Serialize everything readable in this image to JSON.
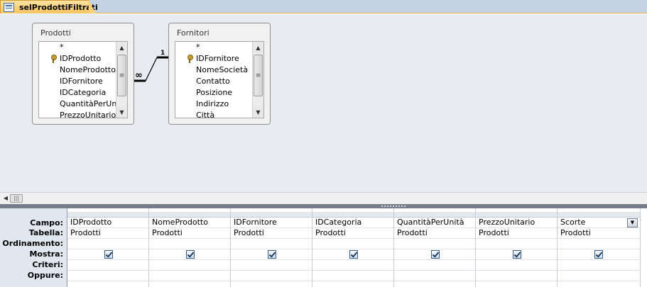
{
  "tab": {
    "icon": "query-icon",
    "label": "selProdottiFiltrati"
  },
  "diagram": {
    "tables": [
      {
        "title": "Prodotti",
        "fields": [
          "*",
          "IDProdotto",
          "NomeProdotto",
          "IDFornitore",
          "IDCategoria",
          "QuantitàPerUni",
          "PrezzoUnitario"
        ],
        "key_field_index": 1
      },
      {
        "title": "Fornitori",
        "fields": [
          "*",
          "IDFornitore",
          "NomeSocietà",
          "Contatto",
          "Posizione",
          "Indirizzo",
          "Città"
        ],
        "key_field_index": 1
      }
    ],
    "relationship": {
      "one_label": "1",
      "many_label": "∞"
    }
  },
  "grid": {
    "row_labels": [
      "Campo:",
      "Tabella:",
      "Ordinamento:",
      "Mostra:",
      "Criteri:",
      "Oppure:"
    ],
    "columns": [
      {
        "field": "IDProdotto",
        "table": "Prodotti",
        "show": true
      },
      {
        "field": "NomeProdotto",
        "table": "Prodotti",
        "show": true
      },
      {
        "field": "IDFornitore",
        "table": "Prodotti",
        "show": true
      },
      {
        "field": "IDCategoria",
        "table": "Prodotti",
        "show": true
      },
      {
        "field": "QuantitàPerUnità",
        "table": "Prodotti",
        "show": true
      },
      {
        "field": "PrezzoUnitario",
        "table": "Prodotti",
        "show": true
      },
      {
        "field": "Scorte",
        "table": "Prodotti",
        "show": true
      }
    ]
  },
  "colors": {
    "tab_active": "#f7c35e",
    "pane_bg": "#e8ecf1",
    "grid_label_bg": "#e1e7ef",
    "splitter": "#757d8a"
  }
}
